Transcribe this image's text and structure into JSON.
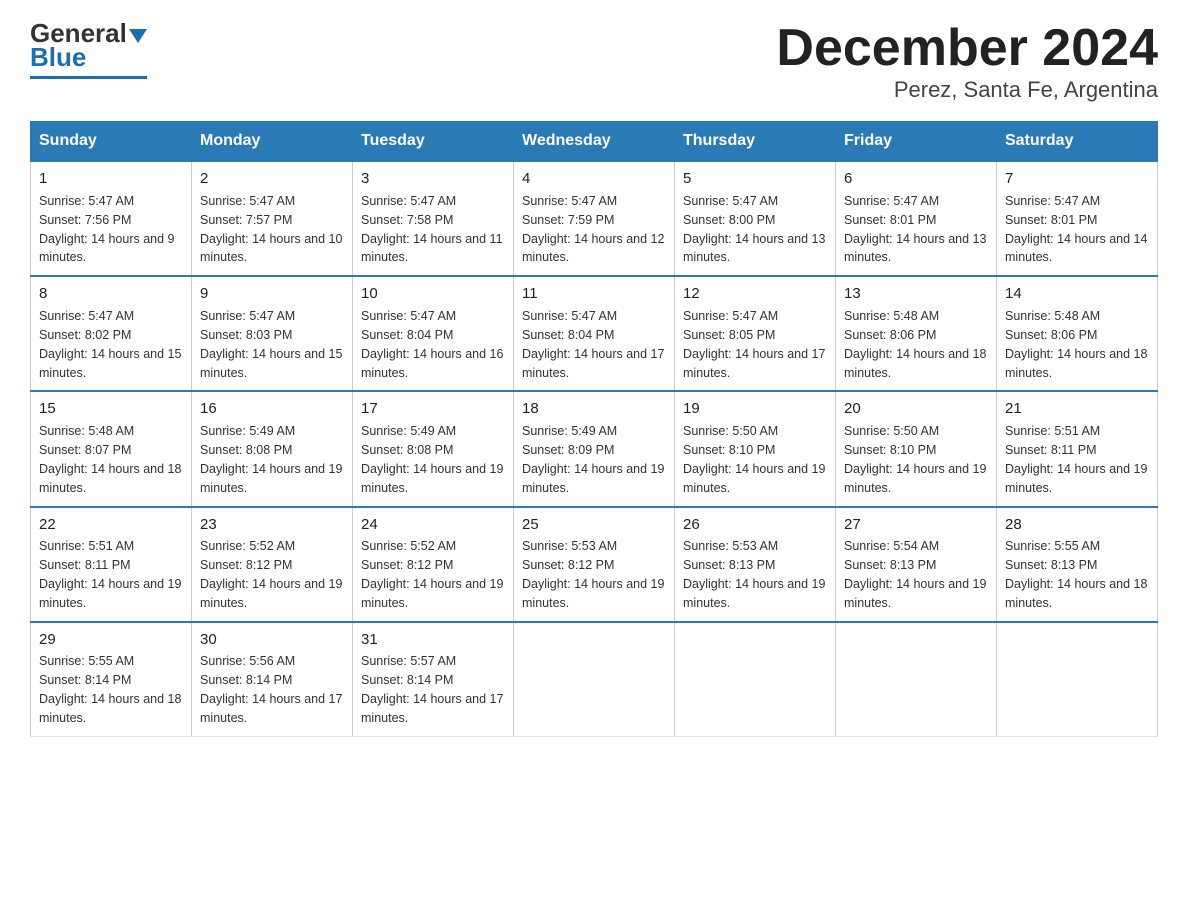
{
  "logo": {
    "general": "General",
    "blue": "Blue"
  },
  "title": "December 2024",
  "subtitle": "Perez, Santa Fe, Argentina",
  "days_header": [
    "Sunday",
    "Monday",
    "Tuesday",
    "Wednesday",
    "Thursday",
    "Friday",
    "Saturday"
  ],
  "weeks": [
    [
      {
        "day": "1",
        "sunrise": "5:47 AM",
        "sunset": "7:56 PM",
        "daylight": "14 hours and 9 minutes."
      },
      {
        "day": "2",
        "sunrise": "5:47 AM",
        "sunset": "7:57 PM",
        "daylight": "14 hours and 10 minutes."
      },
      {
        "day": "3",
        "sunrise": "5:47 AM",
        "sunset": "7:58 PM",
        "daylight": "14 hours and 11 minutes."
      },
      {
        "day": "4",
        "sunrise": "5:47 AM",
        "sunset": "7:59 PM",
        "daylight": "14 hours and 12 minutes."
      },
      {
        "day": "5",
        "sunrise": "5:47 AM",
        "sunset": "8:00 PM",
        "daylight": "14 hours and 13 minutes."
      },
      {
        "day": "6",
        "sunrise": "5:47 AM",
        "sunset": "8:01 PM",
        "daylight": "14 hours and 13 minutes."
      },
      {
        "day": "7",
        "sunrise": "5:47 AM",
        "sunset": "8:01 PM",
        "daylight": "14 hours and 14 minutes."
      }
    ],
    [
      {
        "day": "8",
        "sunrise": "5:47 AM",
        "sunset": "8:02 PM",
        "daylight": "14 hours and 15 minutes."
      },
      {
        "day": "9",
        "sunrise": "5:47 AM",
        "sunset": "8:03 PM",
        "daylight": "14 hours and 15 minutes."
      },
      {
        "day": "10",
        "sunrise": "5:47 AM",
        "sunset": "8:04 PM",
        "daylight": "14 hours and 16 minutes."
      },
      {
        "day": "11",
        "sunrise": "5:47 AM",
        "sunset": "8:04 PM",
        "daylight": "14 hours and 17 minutes."
      },
      {
        "day": "12",
        "sunrise": "5:47 AM",
        "sunset": "8:05 PM",
        "daylight": "14 hours and 17 minutes."
      },
      {
        "day": "13",
        "sunrise": "5:48 AM",
        "sunset": "8:06 PM",
        "daylight": "14 hours and 18 minutes."
      },
      {
        "day": "14",
        "sunrise": "5:48 AM",
        "sunset": "8:06 PM",
        "daylight": "14 hours and 18 minutes."
      }
    ],
    [
      {
        "day": "15",
        "sunrise": "5:48 AM",
        "sunset": "8:07 PM",
        "daylight": "14 hours and 18 minutes."
      },
      {
        "day": "16",
        "sunrise": "5:49 AM",
        "sunset": "8:08 PM",
        "daylight": "14 hours and 19 minutes."
      },
      {
        "day": "17",
        "sunrise": "5:49 AM",
        "sunset": "8:08 PM",
        "daylight": "14 hours and 19 minutes."
      },
      {
        "day": "18",
        "sunrise": "5:49 AM",
        "sunset": "8:09 PM",
        "daylight": "14 hours and 19 minutes."
      },
      {
        "day": "19",
        "sunrise": "5:50 AM",
        "sunset": "8:10 PM",
        "daylight": "14 hours and 19 minutes."
      },
      {
        "day": "20",
        "sunrise": "5:50 AM",
        "sunset": "8:10 PM",
        "daylight": "14 hours and 19 minutes."
      },
      {
        "day": "21",
        "sunrise": "5:51 AM",
        "sunset": "8:11 PM",
        "daylight": "14 hours and 19 minutes."
      }
    ],
    [
      {
        "day": "22",
        "sunrise": "5:51 AM",
        "sunset": "8:11 PM",
        "daylight": "14 hours and 19 minutes."
      },
      {
        "day": "23",
        "sunrise": "5:52 AM",
        "sunset": "8:12 PM",
        "daylight": "14 hours and 19 minutes."
      },
      {
        "day": "24",
        "sunrise": "5:52 AM",
        "sunset": "8:12 PM",
        "daylight": "14 hours and 19 minutes."
      },
      {
        "day": "25",
        "sunrise": "5:53 AM",
        "sunset": "8:12 PM",
        "daylight": "14 hours and 19 minutes."
      },
      {
        "day": "26",
        "sunrise": "5:53 AM",
        "sunset": "8:13 PM",
        "daylight": "14 hours and 19 minutes."
      },
      {
        "day": "27",
        "sunrise": "5:54 AM",
        "sunset": "8:13 PM",
        "daylight": "14 hours and 19 minutes."
      },
      {
        "day": "28",
        "sunrise": "5:55 AM",
        "sunset": "8:13 PM",
        "daylight": "14 hours and 18 minutes."
      }
    ],
    [
      {
        "day": "29",
        "sunrise": "5:55 AM",
        "sunset": "8:14 PM",
        "daylight": "14 hours and 18 minutes."
      },
      {
        "day": "30",
        "sunrise": "5:56 AM",
        "sunset": "8:14 PM",
        "daylight": "14 hours and 17 minutes."
      },
      {
        "day": "31",
        "sunrise": "5:57 AM",
        "sunset": "8:14 PM",
        "daylight": "14 hours and 17 minutes."
      },
      null,
      null,
      null,
      null
    ]
  ]
}
